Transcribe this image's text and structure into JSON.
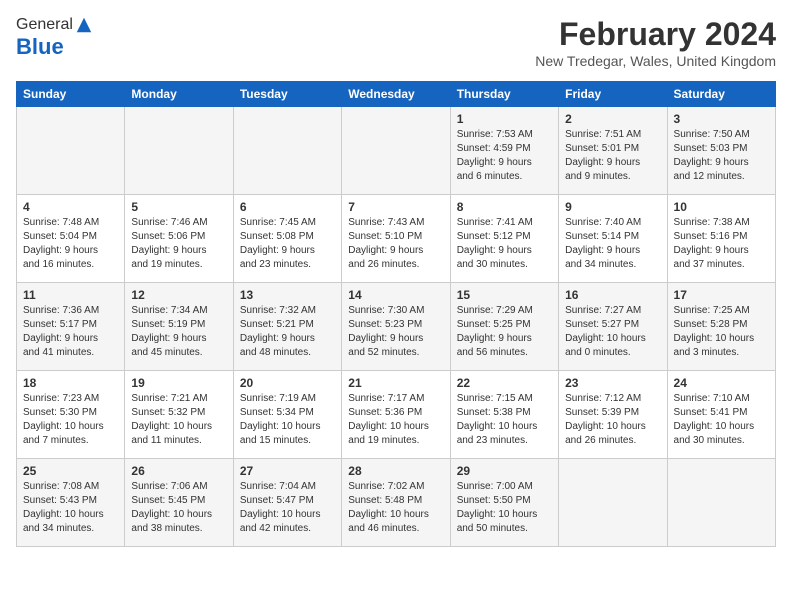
{
  "header": {
    "logo_general": "General",
    "logo_blue": "Blue",
    "month_title": "February 2024",
    "location": "New Tredegar, Wales, United Kingdom"
  },
  "calendar": {
    "days_of_week": [
      "Sunday",
      "Monday",
      "Tuesday",
      "Wednesday",
      "Thursday",
      "Friday",
      "Saturday"
    ],
    "weeks": [
      [
        {
          "day": "",
          "content": ""
        },
        {
          "day": "",
          "content": ""
        },
        {
          "day": "",
          "content": ""
        },
        {
          "day": "",
          "content": ""
        },
        {
          "day": "1",
          "content": "Sunrise: 7:53 AM\nSunset: 4:59 PM\nDaylight: 9 hours\nand 6 minutes."
        },
        {
          "day": "2",
          "content": "Sunrise: 7:51 AM\nSunset: 5:01 PM\nDaylight: 9 hours\nand 9 minutes."
        },
        {
          "day": "3",
          "content": "Sunrise: 7:50 AM\nSunset: 5:03 PM\nDaylight: 9 hours\nand 12 minutes."
        }
      ],
      [
        {
          "day": "4",
          "content": "Sunrise: 7:48 AM\nSunset: 5:04 PM\nDaylight: 9 hours\nand 16 minutes."
        },
        {
          "day": "5",
          "content": "Sunrise: 7:46 AM\nSunset: 5:06 PM\nDaylight: 9 hours\nand 19 minutes."
        },
        {
          "day": "6",
          "content": "Sunrise: 7:45 AM\nSunset: 5:08 PM\nDaylight: 9 hours\nand 23 minutes."
        },
        {
          "day": "7",
          "content": "Sunrise: 7:43 AM\nSunset: 5:10 PM\nDaylight: 9 hours\nand 26 minutes."
        },
        {
          "day": "8",
          "content": "Sunrise: 7:41 AM\nSunset: 5:12 PM\nDaylight: 9 hours\nand 30 minutes."
        },
        {
          "day": "9",
          "content": "Sunrise: 7:40 AM\nSunset: 5:14 PM\nDaylight: 9 hours\nand 34 minutes."
        },
        {
          "day": "10",
          "content": "Sunrise: 7:38 AM\nSunset: 5:16 PM\nDaylight: 9 hours\nand 37 minutes."
        }
      ],
      [
        {
          "day": "11",
          "content": "Sunrise: 7:36 AM\nSunset: 5:17 PM\nDaylight: 9 hours\nand 41 minutes."
        },
        {
          "day": "12",
          "content": "Sunrise: 7:34 AM\nSunset: 5:19 PM\nDaylight: 9 hours\nand 45 minutes."
        },
        {
          "day": "13",
          "content": "Sunrise: 7:32 AM\nSunset: 5:21 PM\nDaylight: 9 hours\nand 48 minutes."
        },
        {
          "day": "14",
          "content": "Sunrise: 7:30 AM\nSunset: 5:23 PM\nDaylight: 9 hours\nand 52 minutes."
        },
        {
          "day": "15",
          "content": "Sunrise: 7:29 AM\nSunset: 5:25 PM\nDaylight: 9 hours\nand 56 minutes."
        },
        {
          "day": "16",
          "content": "Sunrise: 7:27 AM\nSunset: 5:27 PM\nDaylight: 10 hours\nand 0 minutes."
        },
        {
          "day": "17",
          "content": "Sunrise: 7:25 AM\nSunset: 5:28 PM\nDaylight: 10 hours\nand 3 minutes."
        }
      ],
      [
        {
          "day": "18",
          "content": "Sunrise: 7:23 AM\nSunset: 5:30 PM\nDaylight: 10 hours\nand 7 minutes."
        },
        {
          "day": "19",
          "content": "Sunrise: 7:21 AM\nSunset: 5:32 PM\nDaylight: 10 hours\nand 11 minutes."
        },
        {
          "day": "20",
          "content": "Sunrise: 7:19 AM\nSunset: 5:34 PM\nDaylight: 10 hours\nand 15 minutes."
        },
        {
          "day": "21",
          "content": "Sunrise: 7:17 AM\nSunset: 5:36 PM\nDaylight: 10 hours\nand 19 minutes."
        },
        {
          "day": "22",
          "content": "Sunrise: 7:15 AM\nSunset: 5:38 PM\nDaylight: 10 hours\nand 23 minutes."
        },
        {
          "day": "23",
          "content": "Sunrise: 7:12 AM\nSunset: 5:39 PM\nDaylight: 10 hours\nand 26 minutes."
        },
        {
          "day": "24",
          "content": "Sunrise: 7:10 AM\nSunset: 5:41 PM\nDaylight: 10 hours\nand 30 minutes."
        }
      ],
      [
        {
          "day": "25",
          "content": "Sunrise: 7:08 AM\nSunset: 5:43 PM\nDaylight: 10 hours\nand 34 minutes."
        },
        {
          "day": "26",
          "content": "Sunrise: 7:06 AM\nSunset: 5:45 PM\nDaylight: 10 hours\nand 38 minutes."
        },
        {
          "day": "27",
          "content": "Sunrise: 7:04 AM\nSunset: 5:47 PM\nDaylight: 10 hours\nand 42 minutes."
        },
        {
          "day": "28",
          "content": "Sunrise: 7:02 AM\nSunset: 5:48 PM\nDaylight: 10 hours\nand 46 minutes."
        },
        {
          "day": "29",
          "content": "Sunrise: 7:00 AM\nSunset: 5:50 PM\nDaylight: 10 hours\nand 50 minutes."
        },
        {
          "day": "",
          "content": ""
        },
        {
          "day": "",
          "content": ""
        }
      ]
    ]
  }
}
